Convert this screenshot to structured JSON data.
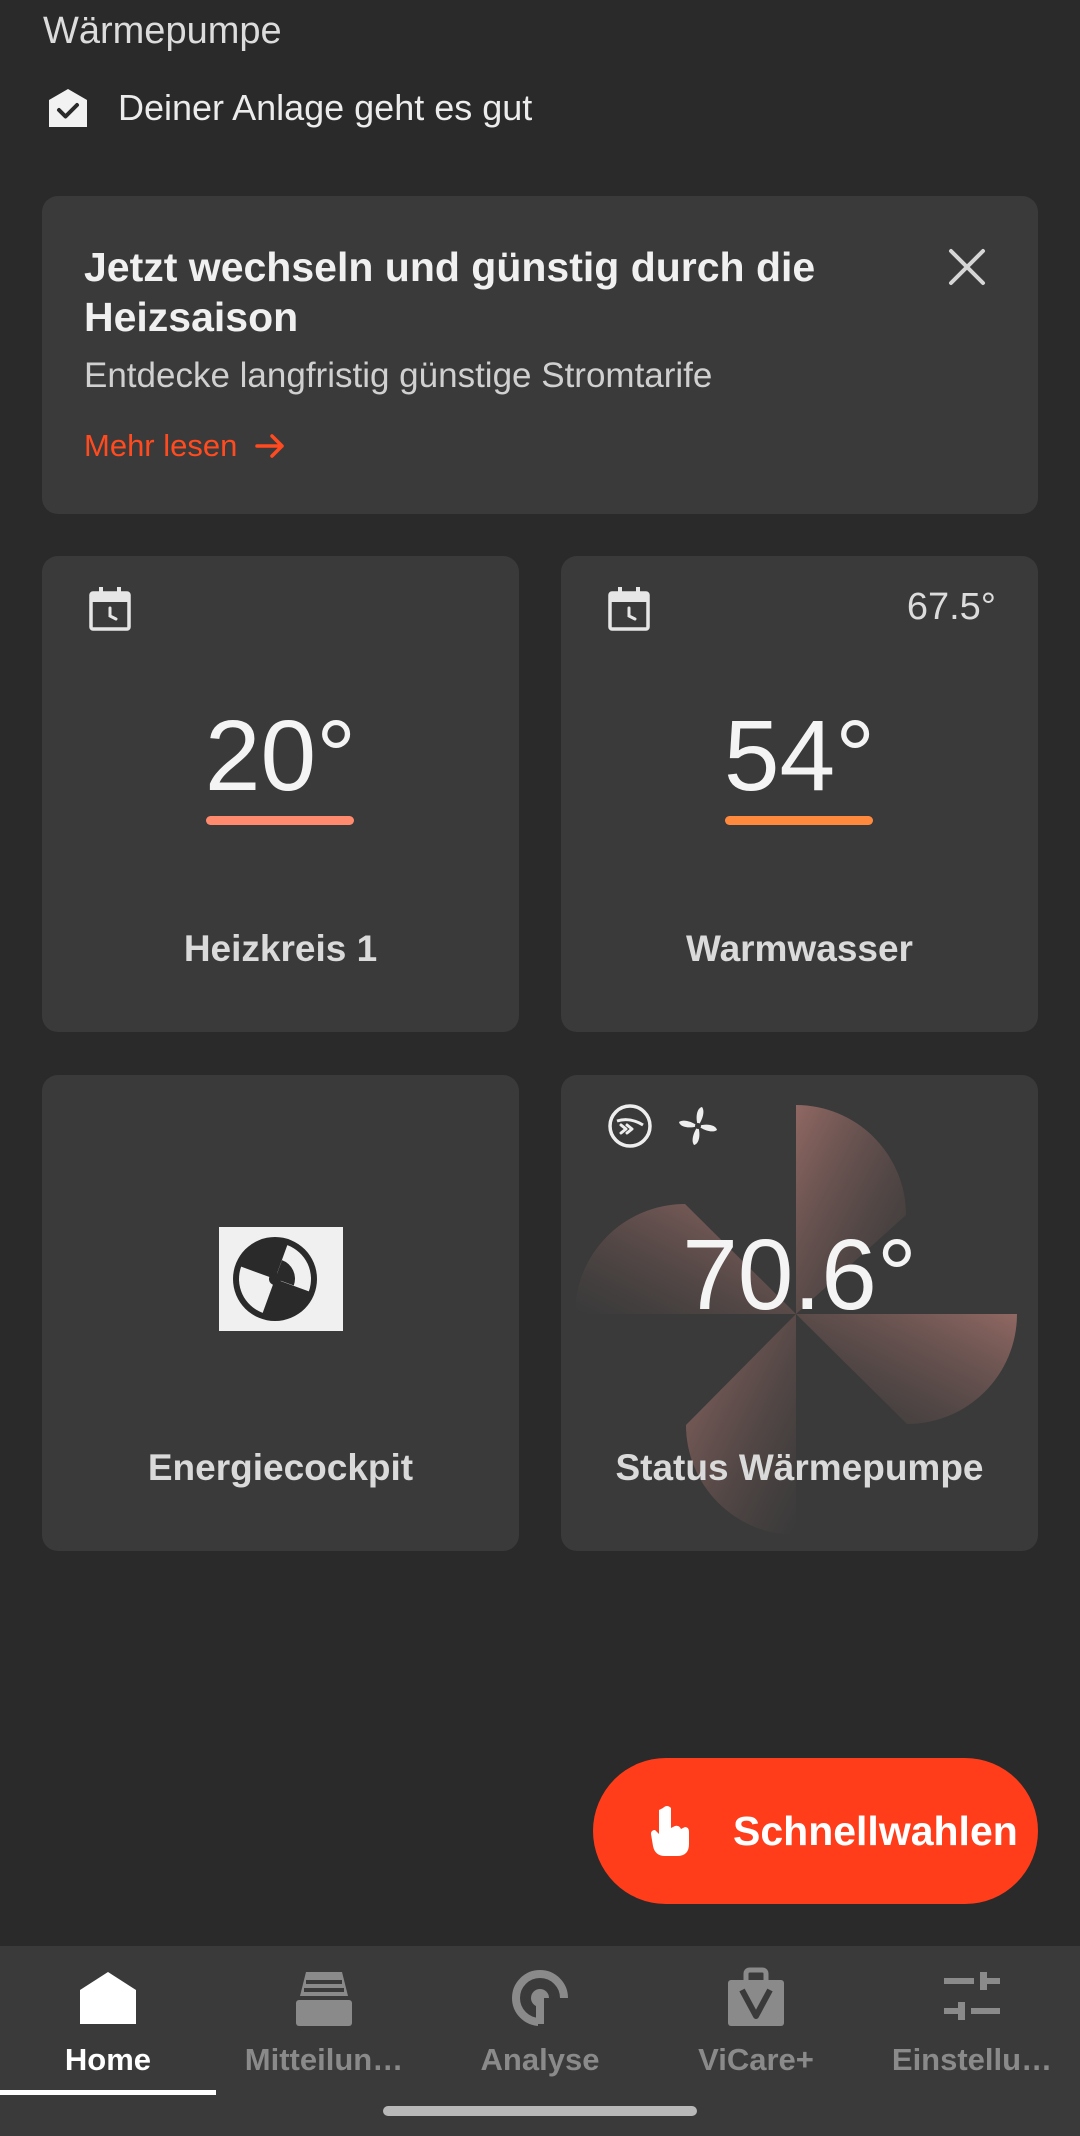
{
  "header": {
    "title": "Wärmepumpe",
    "status_text": "Deiner Anlage geht es gut",
    "status_icon": "house-check-icon"
  },
  "promo": {
    "title": "Jetzt wechseln und günstig durch die Heizsaison",
    "subtitle": "Entdecke langfristig günstige Stromtarife",
    "link_label": "Mehr lesen",
    "accent_color": "#ff4b1f"
  },
  "tiles": {
    "heizkreis": {
      "temperature": "20°",
      "label": "Heizkreis 1",
      "accent_color": "#ff8a6e",
      "icon": "calendar-clock-icon"
    },
    "warmwasser": {
      "temperature": "54°",
      "secondary_temperature": "67.5°",
      "label": "Warmwasser",
      "accent_color": "#ff8a3d",
      "icon": "calendar-clock-icon"
    },
    "energie": {
      "label": "Energiecockpit",
      "icon": "fan-icon"
    },
    "status": {
      "temperature": "70.6°",
      "label": "Status Wärmepumpe",
      "icons": [
        "compressor-icon",
        "fan-icon"
      ]
    }
  },
  "fab": {
    "label": "Schnellwahlen",
    "icon": "hand-pointer-icon",
    "color": "#ff3d1a"
  },
  "bottom_nav": {
    "items": [
      {
        "label": "Home",
        "icon": "home-icon",
        "active": true
      },
      {
        "label": "Mitteilun…",
        "icon": "inbox-icon",
        "active": false
      },
      {
        "label": "Analyse",
        "icon": "analytics-icon",
        "active": false
      },
      {
        "label": "ViCare+",
        "icon": "bag-icon",
        "active": false
      },
      {
        "label": "Einstellu…",
        "icon": "sliders-icon",
        "active": false
      }
    ]
  }
}
